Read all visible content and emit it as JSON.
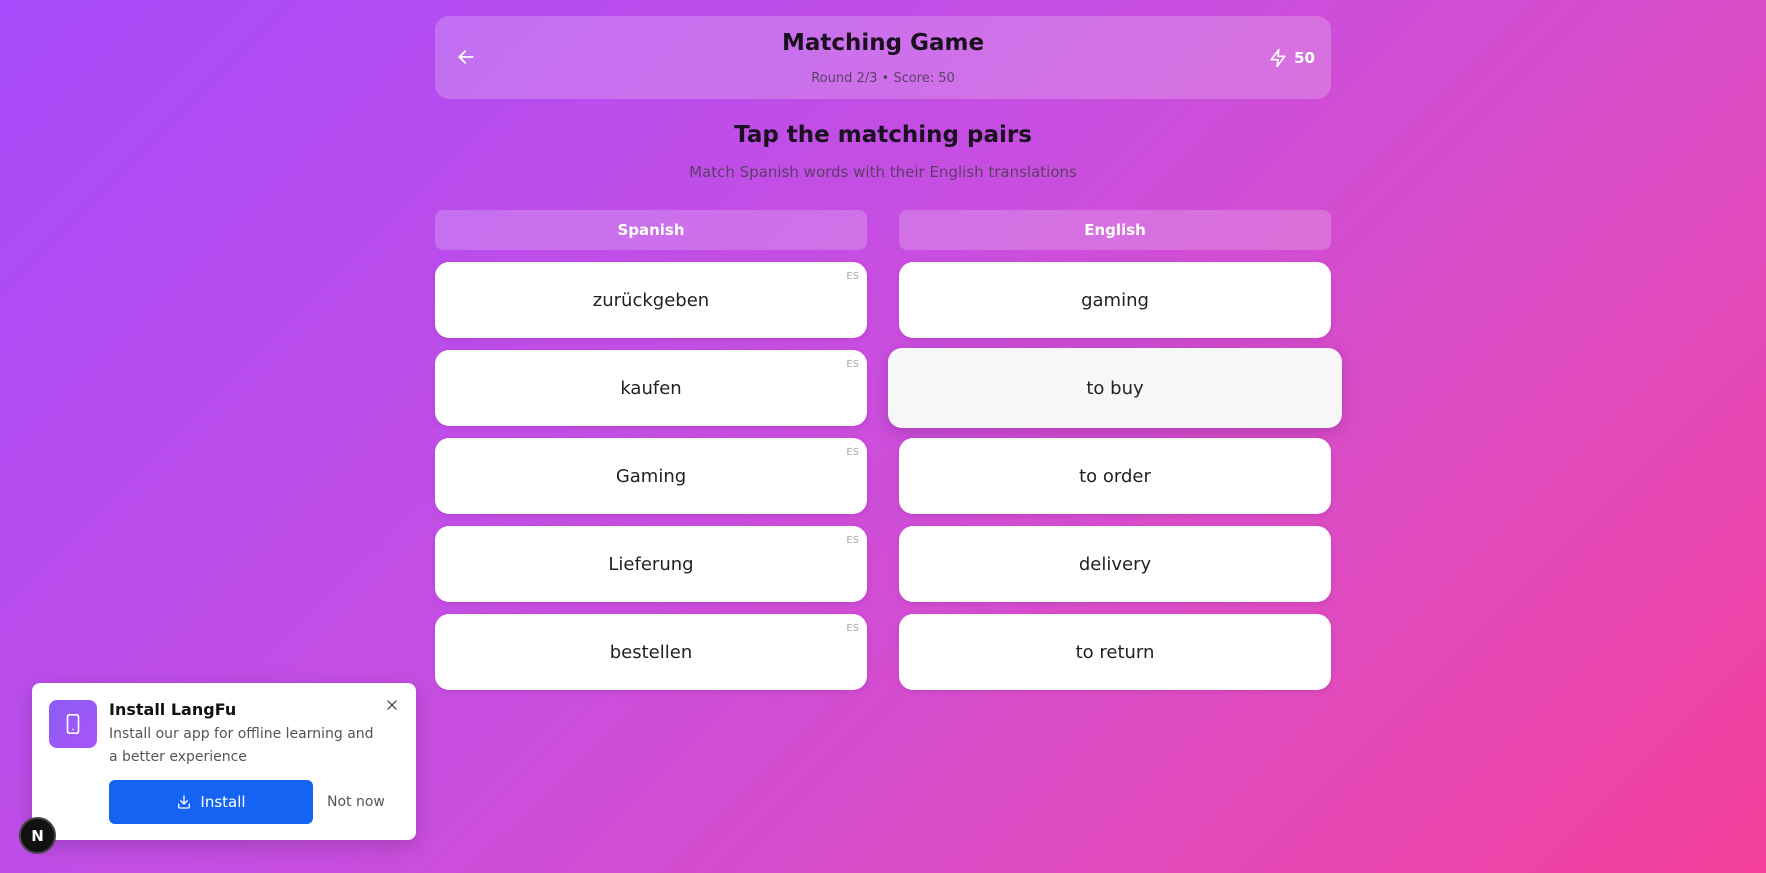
{
  "header": {
    "title": "Matching Game",
    "subtitle": "Round 2/3 • Score: 50",
    "score": "50",
    "back_icon": "arrow-left-icon",
    "score_icon": "lightning-icon"
  },
  "prompt": {
    "title": "Tap the matching pairs",
    "subtitle": "Match Spanish words with their English translations"
  },
  "columns": {
    "left_label": "Spanish",
    "right_label": "English"
  },
  "left_cards": [
    {
      "word": "zurückgeben",
      "tag": "ES"
    },
    {
      "word": "kaufen",
      "tag": "ES"
    },
    {
      "word": "Gaming",
      "tag": "ES"
    },
    {
      "word": "Lieferung",
      "tag": "ES"
    },
    {
      "word": "bestellen",
      "tag": "ES"
    }
  ],
  "right_cards": [
    {
      "word": "gaming"
    },
    {
      "word": "to buy",
      "selected": true
    },
    {
      "word": "to order"
    },
    {
      "word": "delivery"
    },
    {
      "word": "to return"
    }
  ],
  "install_popup": {
    "title": "Install LangFu",
    "description": "Install our app for offline learning and a better experience",
    "install_label": "Install",
    "dismiss_label": "Not now",
    "icon": "smartphone-icon"
  },
  "badge": {
    "letter": "N"
  },
  "colors": {
    "accent_blue": "#1463f3",
    "gradient_start": "#a64bfb",
    "gradient_end": "#f43f9a"
  }
}
